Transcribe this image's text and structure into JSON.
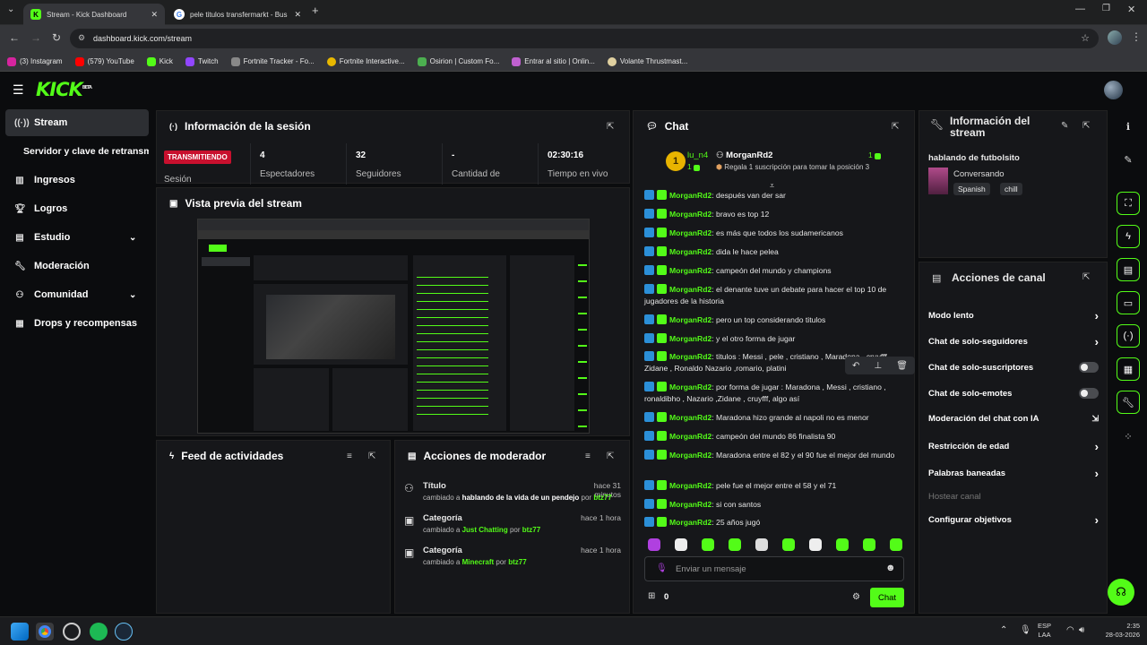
{
  "browser": {
    "tabs": [
      {
        "title": "Stream - Kick Dashboard",
        "icon": "kick-icon"
      },
      {
        "title": "pele titulos transfermarkt - Bus",
        "icon": "google-icon"
      }
    ],
    "url": "dashboard.kick.com/stream",
    "bookmarks": [
      "(3) Instagram",
      "(579) YouTube",
      "Kick",
      "Twitch",
      "Fortnite Tracker - Fo...",
      "Fortnite Interactive...",
      "Osirion | Custom Fo...",
      "Entrar al sitio | Onlin...",
      "Volante Thrustmast..."
    ]
  },
  "kick": {
    "logo": "KICK",
    "logo_sup": "BETA"
  },
  "sidebar": {
    "items": [
      {
        "label": "Stream",
        "icon": "broadcast-icon"
      },
      {
        "label": "Servidor y clave de retransm",
        "icon": ""
      },
      {
        "label": "Ingresos",
        "icon": "chart-icon"
      },
      {
        "label": "Logros",
        "icon": "trophy-icon"
      },
      {
        "label": "Estudio",
        "icon": "studio-icon"
      },
      {
        "label": "Moderación",
        "icon": "wrench-icon"
      },
      {
        "label": "Comunidad",
        "icon": "community-icon"
      },
      {
        "label": "Drops y recompensas",
        "icon": "gift-icon"
      }
    ]
  },
  "session": {
    "title": "Información de la sesión",
    "live_badge": "TRANSMITIENDO",
    "sesion_label": "Sesión",
    "stats": [
      {
        "value": "4",
        "label": "Espectadores"
      },
      {
        "value": "32",
        "label": "Seguidores"
      },
      {
        "value": "-",
        "label": "Cantidad de"
      },
      {
        "value": "02:30:16",
        "label": "Tiempo en vivo"
      }
    ]
  },
  "preview": {
    "title": "Vista previa del stream"
  },
  "feed": {
    "title": "Feed de actividades"
  },
  "modactions": {
    "title": "Acciones de moderador",
    "items": [
      {
        "title": "Título",
        "time": "hace 31 minutos",
        "prefix": "cambiado a",
        "value": "hablando de la vida de un pendejo",
        "by": "por",
        "user": "btz77"
      },
      {
        "title": "Categoría",
        "time": "hace 1 hora",
        "prefix": "cambiado a",
        "value": "Just Chatting",
        "by": "por",
        "user": "btz77"
      },
      {
        "title": "Categoría",
        "time": "hace 1 hora",
        "prefix": "cambiado a",
        "value": "Minecraft",
        "by": "por",
        "user": "btz77"
      }
    ]
  },
  "chat": {
    "title": "Chat",
    "leader": {
      "rank": "1",
      "name": "lu_n4",
      "count": "1",
      "user": "MorganRd2",
      "user_count": "1",
      "gift_text": "Regala 1 suscripción para tomar la posición 3"
    },
    "messages": [
      {
        "user": "MorganRd2",
        "text": "después van der sar"
      },
      {
        "user": "MorganRd2",
        "text": "bravo es top 12"
      },
      {
        "user": "MorganRd2",
        "text": "es más que todos los sudamericanos"
      },
      {
        "user": "MorganRd2",
        "text": "dida le hace pelea"
      },
      {
        "user": "MorganRd2",
        "text": "campeón del mundo y champions"
      },
      {
        "user": "MorganRd2",
        "text": "el denante tuve un debate para hacer el top 10 de jugadores de la historia"
      },
      {
        "user": "MorganRd2",
        "text": "pero un top considerando titulos"
      },
      {
        "user": "MorganRd2",
        "text": "y el otro forma de jugar"
      },
      {
        "user": "MorganRd2",
        "text": "titulos : Messi , pele , cristiano , Maradona , cruyfff, Zidane , Ronaldo Nazario ,romario, platini"
      },
      {
        "user": "MorganRd2",
        "text": "por forma de jugar : Maradona , Messi , cristiano , ronaldibho , Nazario ,Zidane , cruyfff, algo así"
      },
      {
        "user": "MorganRd2",
        "text": "Maradona hizo grande al napoli no es menor"
      },
      {
        "user": "MorganRd2",
        "text": "campeón del mundo 86 finalista 90"
      },
      {
        "user": "MorganRd2",
        "text": "Maradona entre el 82 y el 90 fue el mejor del mundo"
      },
      {
        "user": "MorganRd2",
        "text": "pele fue el mejor entre el 58 y el 71"
      },
      {
        "user": "MorganRd2",
        "text": "si con santos"
      },
      {
        "user": "MorganRd2",
        "text": "25 años jugó"
      }
    ],
    "placeholder": "Enviar un mensaje",
    "points": "0",
    "send": "Chat"
  },
  "streaminfo": {
    "title": "Información del stream",
    "stream_title": "hablando de futbolsito",
    "category": "Conversando",
    "tags": [
      "Spanish",
      "chill"
    ]
  },
  "channel": {
    "title": "Acciones de canal",
    "items": [
      {
        "label": "Modo lento",
        "control": "chevron"
      },
      {
        "label": "Chat de solo-seguidores",
        "control": "chevron"
      },
      {
        "label": "Chat de solo-suscriptores",
        "control": "toggle"
      },
      {
        "label": "Chat de solo-emotes",
        "control": "toggle"
      },
      {
        "label": "Moderación del chat con IA",
        "control": "external"
      },
      {
        "label": "Restricción de edad",
        "control": "chevron"
      },
      {
        "label": "Palabras baneadas",
        "control": "chevron"
      },
      {
        "label": "Hostear canal",
        "control": "none"
      },
      {
        "label": "Configurar objetivos",
        "control": "chevron"
      }
    ]
  },
  "taskbar": {
    "lang": "ESP",
    "layout": "LAA",
    "time": "2:35",
    "date": "28-03-2026"
  },
  "colors": {
    "accent": "#53fc18",
    "live": "#c8102e",
    "panel": "#16171a"
  }
}
